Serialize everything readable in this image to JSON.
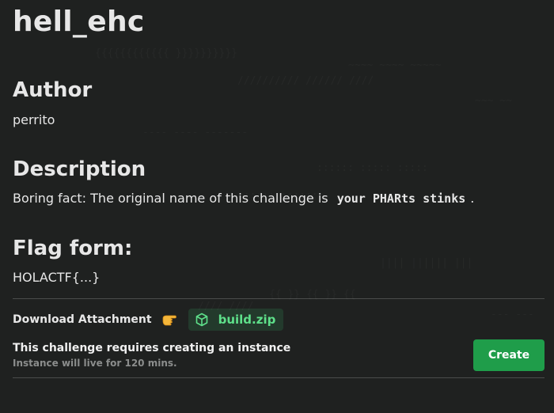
{
  "challenge": {
    "title": "hell_ehc"
  },
  "author": {
    "heading": "Author",
    "name": "perrito"
  },
  "description": {
    "heading": "Description",
    "text_before": "Boring fact: The original name of this challenge is",
    "code": "your PHARts stinks",
    "text_after": "."
  },
  "flag": {
    "heading": "Flag form:",
    "format": "HOLACTF{...}"
  },
  "attachment": {
    "label": "Download Attachment",
    "pointer_icon": "backhand-index-pointing-right-icon",
    "file_icon": "package-box-icon",
    "file_name": "build.zip"
  },
  "instance": {
    "title": "This challenge requires creating an instance",
    "subtitle": "Instance will live for 120 mins.",
    "create_label": "Create"
  },
  "colors": {
    "background": "#1f2120",
    "accent_green": "#1f9d4a",
    "chip_text_green": "#5ee08a",
    "chip_bg": "#233a2c"
  }
}
